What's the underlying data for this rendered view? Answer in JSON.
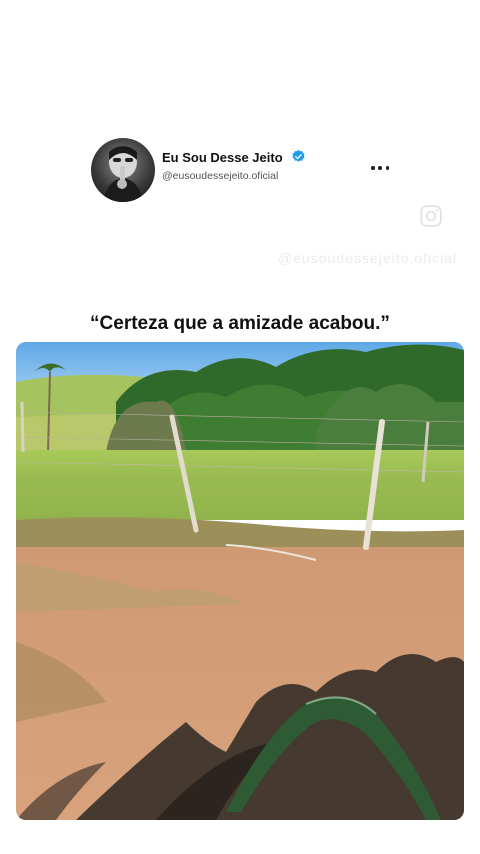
{
  "post": {
    "author_name": "Eu Sou Desse Jeito",
    "author_handle": "@eusoudessejeito.oficial",
    "verified": true,
    "quote": "“Certeza que a amizade acabou.”",
    "watermark": "@eusoudessejeito.oficial"
  },
  "icons": {
    "verified": "verified-badge-icon",
    "more": "more-options-icon",
    "watermark": "instagram-icon"
  },
  "colors": {
    "verified_blue": "#1d9bf0",
    "text": "#111111",
    "handle": "#555555"
  }
}
